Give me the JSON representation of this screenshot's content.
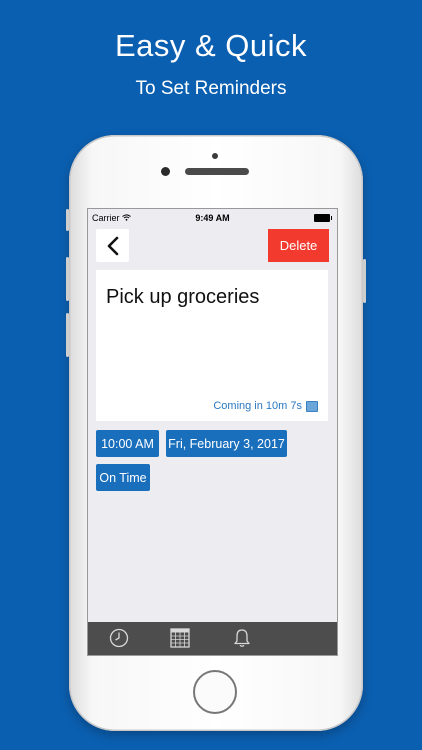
{
  "promo": {
    "headline": "Easy & Quick",
    "subheadline": "To Set Reminders"
  },
  "status_bar": {
    "carrier": "Carrier",
    "time": "9:49 AM"
  },
  "toolbar": {
    "back_icon": "chevron-left-icon",
    "delete_label": "Delete"
  },
  "reminder": {
    "title": "Pick up groceries",
    "countdown": "Coming in 10m 7s",
    "countdown_icon": "calendar-icon"
  },
  "chips": {
    "time": "10:00 AM",
    "date": "Fri, February 3, 2017",
    "alert_type": "On Time"
  },
  "tab_bar": {
    "items": [
      {
        "icon": "clock-icon"
      },
      {
        "icon": "calendar-grid-icon"
      },
      {
        "icon": "bell-icon"
      }
    ]
  },
  "colors": {
    "background": "#0b5fb0",
    "delete": "#f23a2f",
    "chip": "#1a6fbd",
    "tab_bar": "#4d4d4d"
  }
}
